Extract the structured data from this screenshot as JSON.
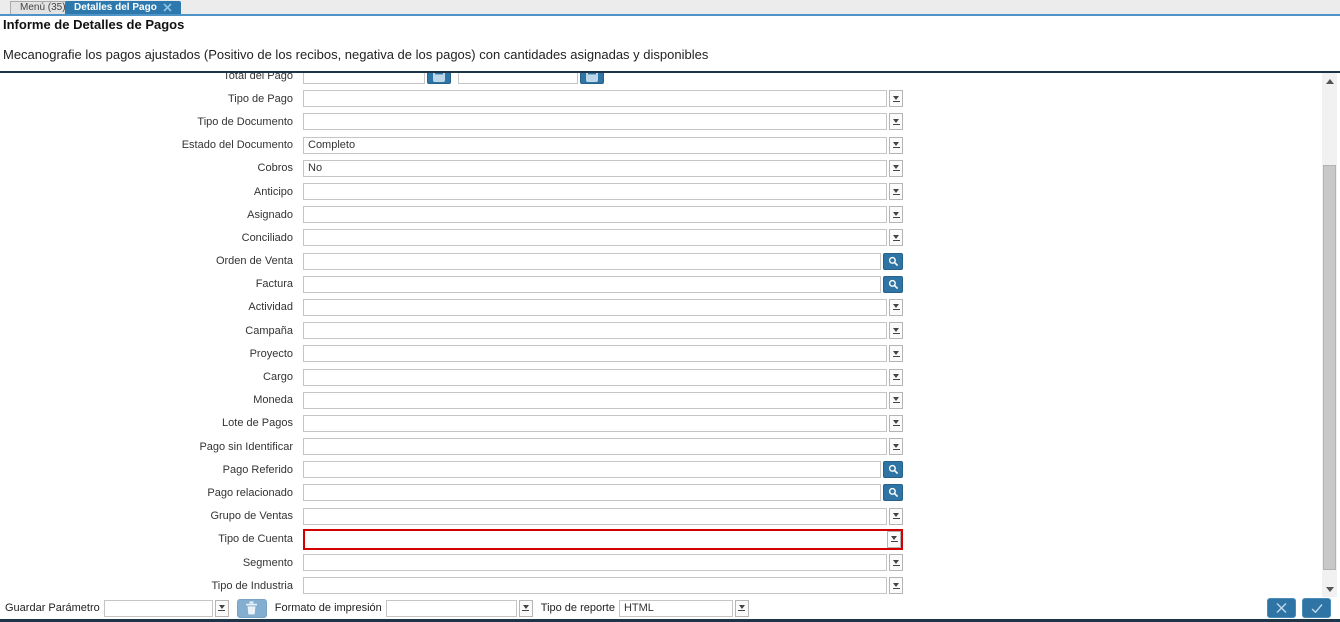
{
  "tabs": [
    {
      "label": "Menú (35)",
      "active": false
    },
    {
      "label": "Detalles del Pago",
      "active": true,
      "closable": true
    }
  ],
  "header": {
    "title": "Informe de Detalles de Pagos",
    "description": "Mecanografie los pagos ajustados (Positivo de los recibos, negativa de los pagos) con cantidades asignadas y disponibles"
  },
  "form": {
    "rows": [
      {
        "id": "total-del-pago",
        "label": "Total del Pago",
        "type": "amount",
        "value": "",
        "value2": "",
        "clipped": true
      },
      {
        "id": "tipo-de-pago",
        "label": "Tipo de Pago",
        "type": "select",
        "value": ""
      },
      {
        "id": "tipo-de-documento",
        "label": "Tipo de Documento",
        "type": "select",
        "value": ""
      },
      {
        "id": "estado-del-documento",
        "label": "Estado del Documento",
        "type": "select",
        "value": "Completo"
      },
      {
        "id": "cobros",
        "label": "Cobros",
        "type": "select",
        "value": "No"
      },
      {
        "id": "anticipo",
        "label": "Anticipo",
        "type": "select",
        "value": ""
      },
      {
        "id": "asignado",
        "label": "Asignado",
        "type": "select",
        "value": ""
      },
      {
        "id": "conciliado",
        "label": "Conciliado",
        "type": "select",
        "value": ""
      },
      {
        "id": "orden-de-venta",
        "label": "Orden de Venta",
        "type": "search",
        "value": ""
      },
      {
        "id": "factura",
        "label": "Factura",
        "type": "search",
        "value": ""
      },
      {
        "id": "actividad",
        "label": "Actividad",
        "type": "select",
        "value": ""
      },
      {
        "id": "campana",
        "label": "Campaña",
        "type": "select",
        "value": ""
      },
      {
        "id": "proyecto",
        "label": "Proyecto",
        "type": "select",
        "value": ""
      },
      {
        "id": "cargo",
        "label": "Cargo",
        "type": "select",
        "value": ""
      },
      {
        "id": "moneda",
        "label": "Moneda",
        "type": "select",
        "value": ""
      },
      {
        "id": "lote-de-pagos",
        "label": "Lote de Pagos",
        "type": "select",
        "value": ""
      },
      {
        "id": "pago-sin-identificar",
        "label": "Pago sin Identificar",
        "type": "select",
        "value": ""
      },
      {
        "id": "pago-referido",
        "label": "Pago Referido",
        "type": "search",
        "value": ""
      },
      {
        "id": "pago-relacionado",
        "label": "Pago relacionado",
        "type": "search",
        "value": ""
      },
      {
        "id": "grupo-de-ventas",
        "label": "Grupo de Ventas",
        "type": "select",
        "value": ""
      },
      {
        "id": "tipo-de-cuenta",
        "label": "Tipo de Cuenta",
        "type": "select",
        "value": "",
        "error": true
      },
      {
        "id": "segmento",
        "label": "Segmento",
        "type": "select",
        "value": ""
      },
      {
        "id": "tipo-de-industria",
        "label": "Tipo de Industria",
        "type": "select",
        "value": ""
      }
    ]
  },
  "footer": {
    "save_label": "Guardar Parámetro",
    "save_value": "",
    "print_format_label": "Formato de impresión",
    "print_format_value": "",
    "report_type_label": "Tipo de reporte",
    "report_type_value": "HTML"
  },
  "icons": {
    "tab_close": "close-icon",
    "lookup": "search-icon",
    "amount_button": "calculator-icon",
    "delete": "trash-icon",
    "cancel": "x-icon",
    "confirm": "check-icon",
    "combo": "chevron-down-icon",
    "scrollbar": [
      "triangle-up-icon",
      "triangle-down-icon"
    ]
  },
  "colors": {
    "accent_blue": "#2e74a4",
    "active_tab": "#2d79ae",
    "tab_underline": "#4e94c6",
    "navy_divider": "#1e3448",
    "field_border": "#c5c5c5",
    "error_border": "#d40000",
    "disabled_button": "#84aed0"
  }
}
